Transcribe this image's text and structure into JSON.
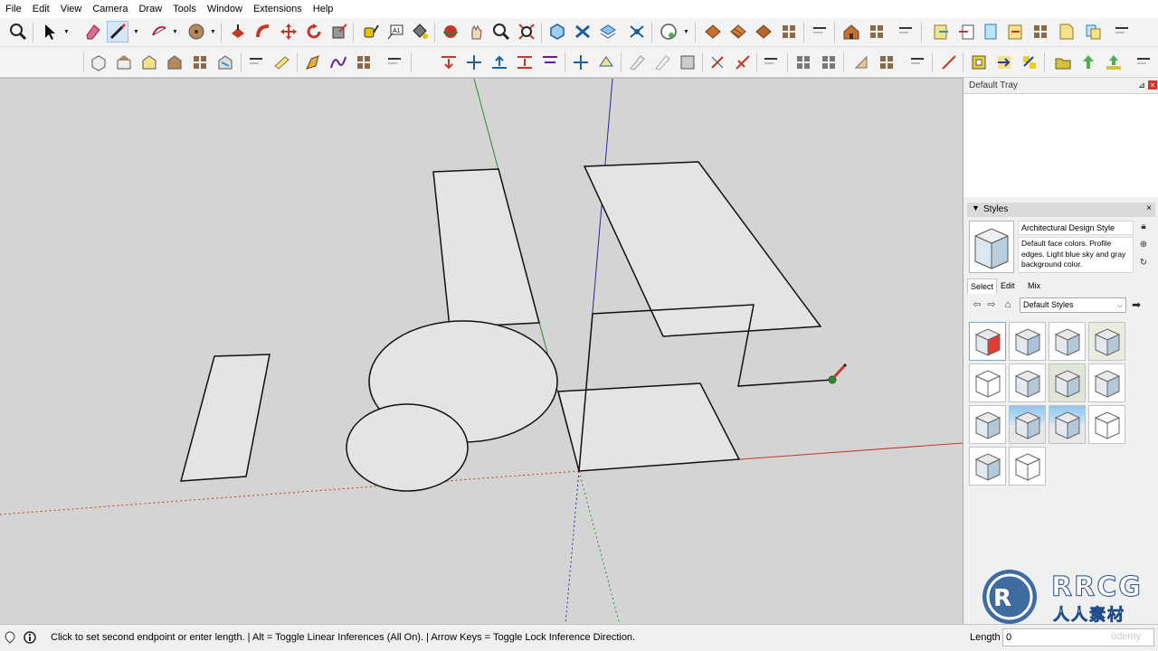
{
  "menu": [
    "File",
    "Edit",
    "View",
    "Camera",
    "Draw",
    "Tools",
    "Window",
    "Extensions",
    "Help"
  ],
  "tray": {
    "title": "Default Tray",
    "styles": {
      "title": "Styles",
      "current_name": "Architectural Design Style",
      "current_description": "Default face colors. Profile edges. Light blue sky and gray background color.",
      "tabs": [
        "Select",
        "Edit",
        "Mix"
      ],
      "active_tab": "Select",
      "collection": "Default Styles",
      "swatch_count": 14,
      "selected_swatch": 0
    }
  },
  "statusbar": {
    "message": "Click to set second endpoint or enter length. | Alt = Toggle Linear Inferences (All On). | Arrow Keys = Toggle Lock Inference Direction.",
    "vcb_label": "Length",
    "vcb_value": "0"
  },
  "active_tool": "line-tool",
  "colors": {
    "viewport_bg": "#d4d4d4",
    "face": "#e4e4e4",
    "axis_red": "#c0392b",
    "axis_green": "#2e8b2e",
    "axis_blue": "#2a2a9a",
    "accent": "#5a9fd4"
  },
  "watermark": {
    "brand": "RRCG",
    "brand_cn": "人人素材",
    "udemy": "ûdemy"
  }
}
